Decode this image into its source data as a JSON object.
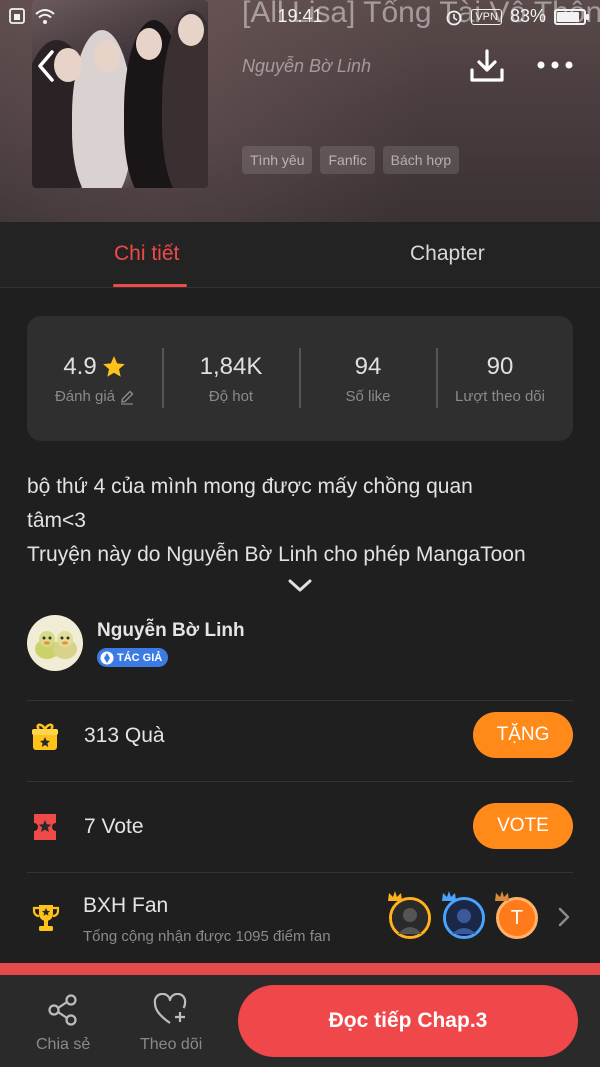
{
  "status_bar": {
    "time": "19:41",
    "vpn": "VPN",
    "battery": "83%",
    "battery_level": 0.83
  },
  "story": {
    "title": "[All Lisa] Tổng Tài Vô Thôn Lấy Vợ!!",
    "author": "Nguyễn Bờ Linh",
    "tags": [
      "Tình yêu",
      "Fanfic",
      "Bách hợp"
    ]
  },
  "tabs": [
    {
      "label": "Chi tiết",
      "active": true
    },
    {
      "label": "Chapter",
      "active": false
    }
  ],
  "stats": [
    {
      "value": "4.9",
      "label": "Đánh giá"
    },
    {
      "value": "1,84K",
      "label": "Độ hot"
    },
    {
      "value": "94",
      "label": "Số like"
    },
    {
      "value": "90",
      "label": "Lượt theo dõi"
    }
  ],
  "description": {
    "line1": "bộ thứ 4 của mình mong được mấy chồng quan",
    "line2": "tâm<3",
    "line3": "Truyện này do Nguyễn Bờ Linh cho phép MangaToon"
  },
  "author_card": {
    "name": "Nguyễn Bờ Linh",
    "badge": "TÁC GIẢ"
  },
  "gifts": {
    "count": "313",
    "label": "Quà",
    "button": "TẶNG"
  },
  "votes": {
    "count": "7",
    "label": "Vote",
    "button": "VOTE"
  },
  "fan_ranking": {
    "title": "BXH Fan",
    "subtitle": "Tổng cộng nhận được 1095 điểm fan",
    "third_avatar_letter": "T"
  },
  "bottom_bar": {
    "share": "Chia sẻ",
    "follow": "Theo dõi",
    "read": "Đọc tiếp Chap.3"
  },
  "colors": {
    "accent": "#ee4a4a",
    "orange": "#ff8a1a",
    "read_button": "#f0484a",
    "badge": "#3c7be3"
  }
}
